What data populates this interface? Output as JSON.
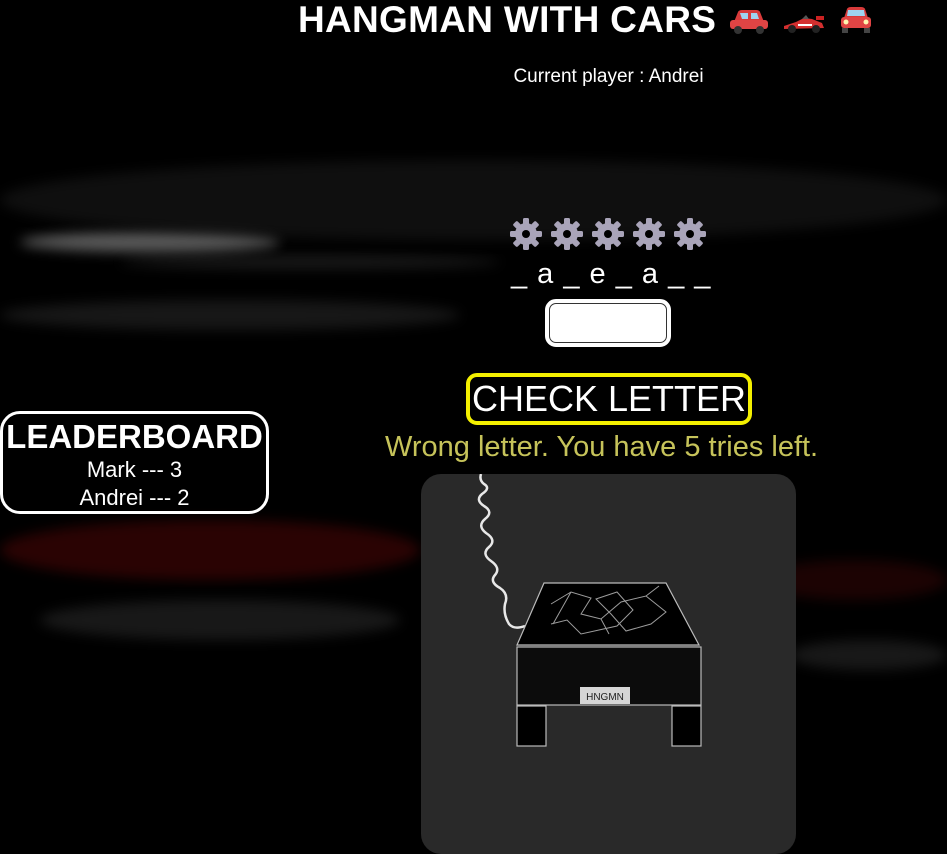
{
  "header": {
    "title": "HANGMAN WITH CARS",
    "emojis": [
      "car-emoji",
      "race-car-emoji",
      "car-front-emoji"
    ]
  },
  "game": {
    "current_player": "Current player : Andrei",
    "lives_icon": "gear-icon",
    "lives_remaining": 5,
    "masked_word": "_ a _ e _ a _ _",
    "letter_input_value": "",
    "check_button_label": "CHECK LETTER",
    "status_message": "Wrong letter. You have 5 tries left."
  },
  "leaderboard": {
    "title": "LEADERBOARD",
    "entries": [
      "Mark --- 3",
      "Andrei --- 2"
    ]
  },
  "drawing": {
    "plate_text": "HNGMN"
  },
  "colors": {
    "button_border": "#f4f000",
    "message": "#c6c35a",
    "gear": "#a9a4b9",
    "panel": "#292929"
  }
}
